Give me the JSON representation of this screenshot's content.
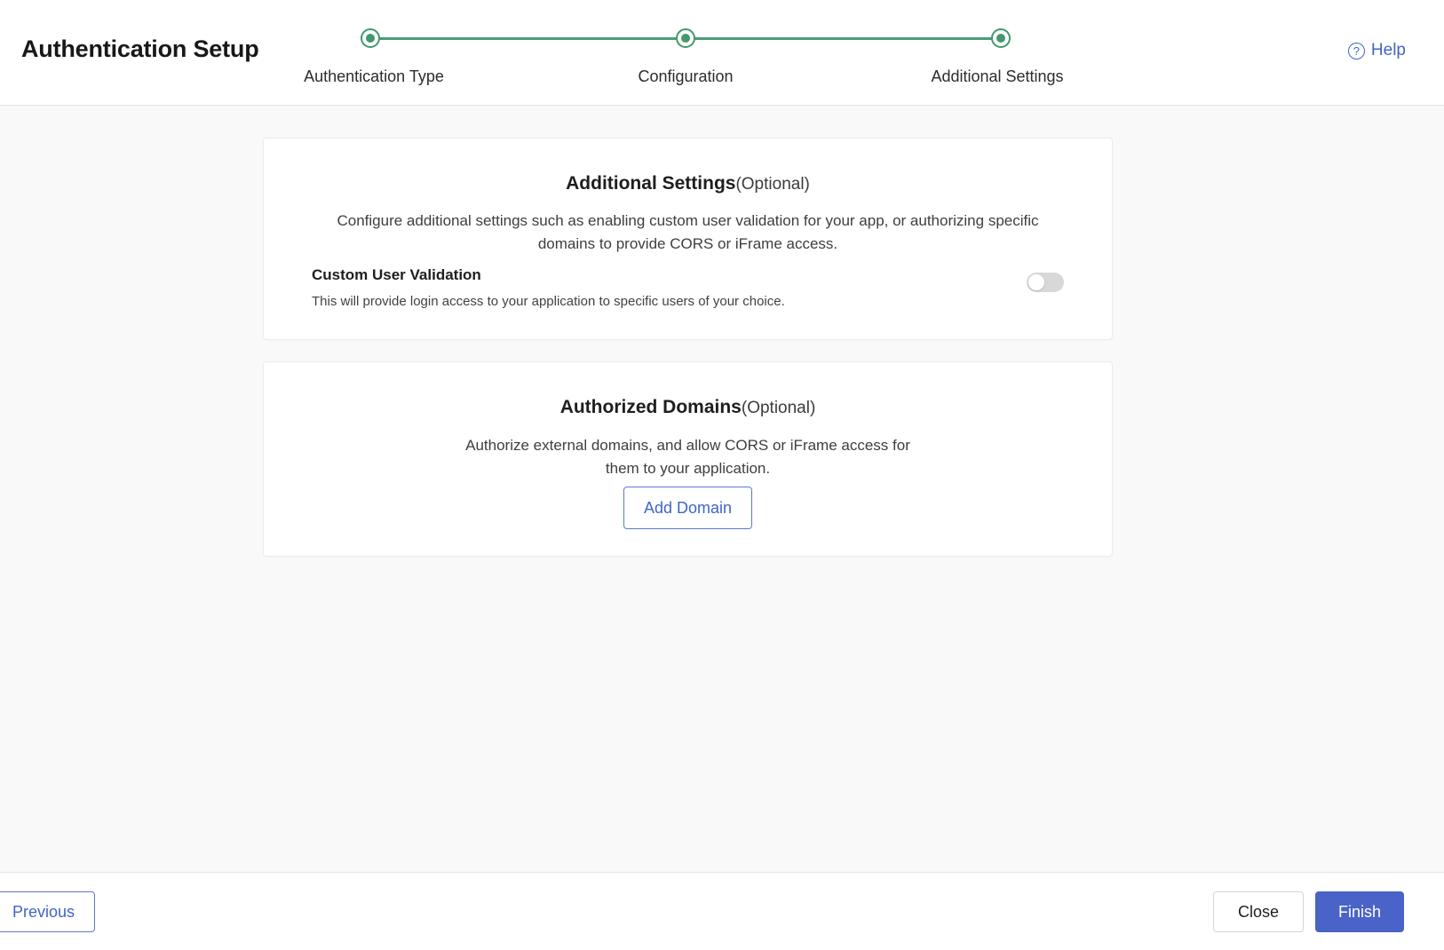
{
  "header": {
    "title": "Authentication Setup",
    "help": {
      "label": "Help",
      "icon": "question-circle-icon"
    }
  },
  "stepper": {
    "steps": [
      {
        "label": "Authentication Type",
        "state": "complete"
      },
      {
        "label": "Configuration",
        "state": "complete"
      },
      {
        "label": "Additional Settings",
        "state": "active"
      }
    ],
    "accent_color": "#41996d"
  },
  "cards": {
    "additional_settings": {
      "heading": "Additional Settings",
      "heading_optional": "(Optional)",
      "description": "Configure additional settings such as enabling custom user validation for your app, or authorizing specific domains to provide CORS or iFrame access.",
      "setting": {
        "title": "Custom User Validation",
        "subtitle": "This will provide login access to your application to specific users of your choice.",
        "toggle_state": "off"
      }
    },
    "authorized_domains": {
      "heading": "Authorized Domains",
      "heading_optional": "(Optional)",
      "description": "Authorize external domains, and allow CORS or iFrame access for them to your application.",
      "add_button_label": "Add Domain"
    }
  },
  "footer": {
    "previous_label": "Previous",
    "close_label": "Close",
    "finish_label": "Finish",
    "primary_color": "#4a63c8"
  }
}
